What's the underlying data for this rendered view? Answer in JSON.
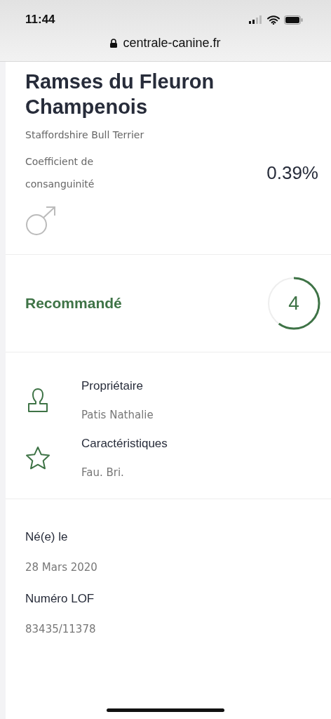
{
  "status_bar": {
    "time": "11:44"
  },
  "address_bar": {
    "url": "centrale-canine.fr"
  },
  "dog": {
    "name": "Ramses du Fleuron Champenois",
    "breed": "Staffordshire Bull Terrier",
    "coefficient_label": "Coefficient de consanguinité",
    "coefficient_value": "0.39%",
    "sex_icon": {
      "kind": "male"
    }
  },
  "recommendation": {
    "label": "Recommandé",
    "score": "4"
  },
  "details": [
    {
      "kind": "owner",
      "label": "Propriétaire",
      "value": "Patis Nathalie"
    },
    {
      "kind": "traits",
      "label": "Caractéristiques",
      "value": "Fau. Bri."
    }
  ],
  "facts": [
    {
      "label": "Né(e) le",
      "value": "28 Mars 2020"
    },
    {
      "label": "Numéro LOF",
      "value": "83435/11378"
    }
  ]
}
